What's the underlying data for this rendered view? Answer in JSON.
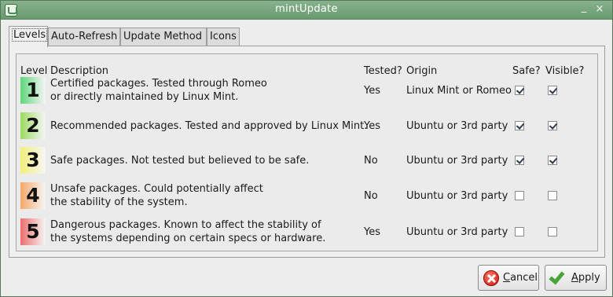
{
  "window": {
    "title": "mintUpdate"
  },
  "titlebar": {
    "minimize_glyph": "_",
    "close_glyph": "×"
  },
  "tabs": [
    {
      "label": "Levels",
      "active": true
    },
    {
      "label": "Auto-Refresh",
      "active": false
    },
    {
      "label": "Update Method",
      "active": false
    },
    {
      "label": "Icons",
      "active": false
    }
  ],
  "table": {
    "headers": {
      "level": "Level",
      "description": "Description",
      "tested": "Tested?",
      "origin": "Origin",
      "safe": "Safe?",
      "visible": "Visible?"
    },
    "rows": [
      {
        "level": "1",
        "color": "#5fd67a",
        "description_line1": "Certified packages. Tested through Romeo",
        "description_line2": "or directly maintained by Linux Mint.",
        "tested": "Yes",
        "origin": "Linux Mint or Romeo",
        "safe": true,
        "visible": true
      },
      {
        "level": "2",
        "color": "#9bdc61",
        "description_line1": "Recommended packages. Tested and approved by Linux Mint.",
        "description_line2": "",
        "tested": "Yes",
        "origin": "Ubuntu or 3rd party",
        "safe": true,
        "visible": true
      },
      {
        "level": "3",
        "color": "#f4ef7a",
        "description_line1": "Safe packages. Not tested but believed to be safe.",
        "description_line2": "",
        "tested": "No",
        "origin": "Ubuntu or 3rd party",
        "safe": true,
        "visible": true
      },
      {
        "level": "4",
        "color": "#f5a869",
        "description_line1": "Unsafe packages. Could potentially affect",
        "description_line2": "the stability of the system.",
        "tested": "No",
        "origin": "Ubuntu or 3rd party",
        "safe": false,
        "visible": false
      },
      {
        "level": "5",
        "color": "#ee6d6d",
        "description_line1": "Dangerous packages. Known to affect the stability of",
        "description_line2": "the  systems depending on certain specs or hardware.",
        "tested": "Yes",
        "origin": "Ubuntu or 3rd party",
        "safe": false,
        "visible": false
      }
    ]
  },
  "buttons": {
    "cancel": {
      "label_first": "C",
      "label_rest": "ancel",
      "icon": "cancel-icon"
    },
    "apply": {
      "label_first": "A",
      "label_rest": "pply",
      "icon": "apply-check-icon"
    }
  }
}
